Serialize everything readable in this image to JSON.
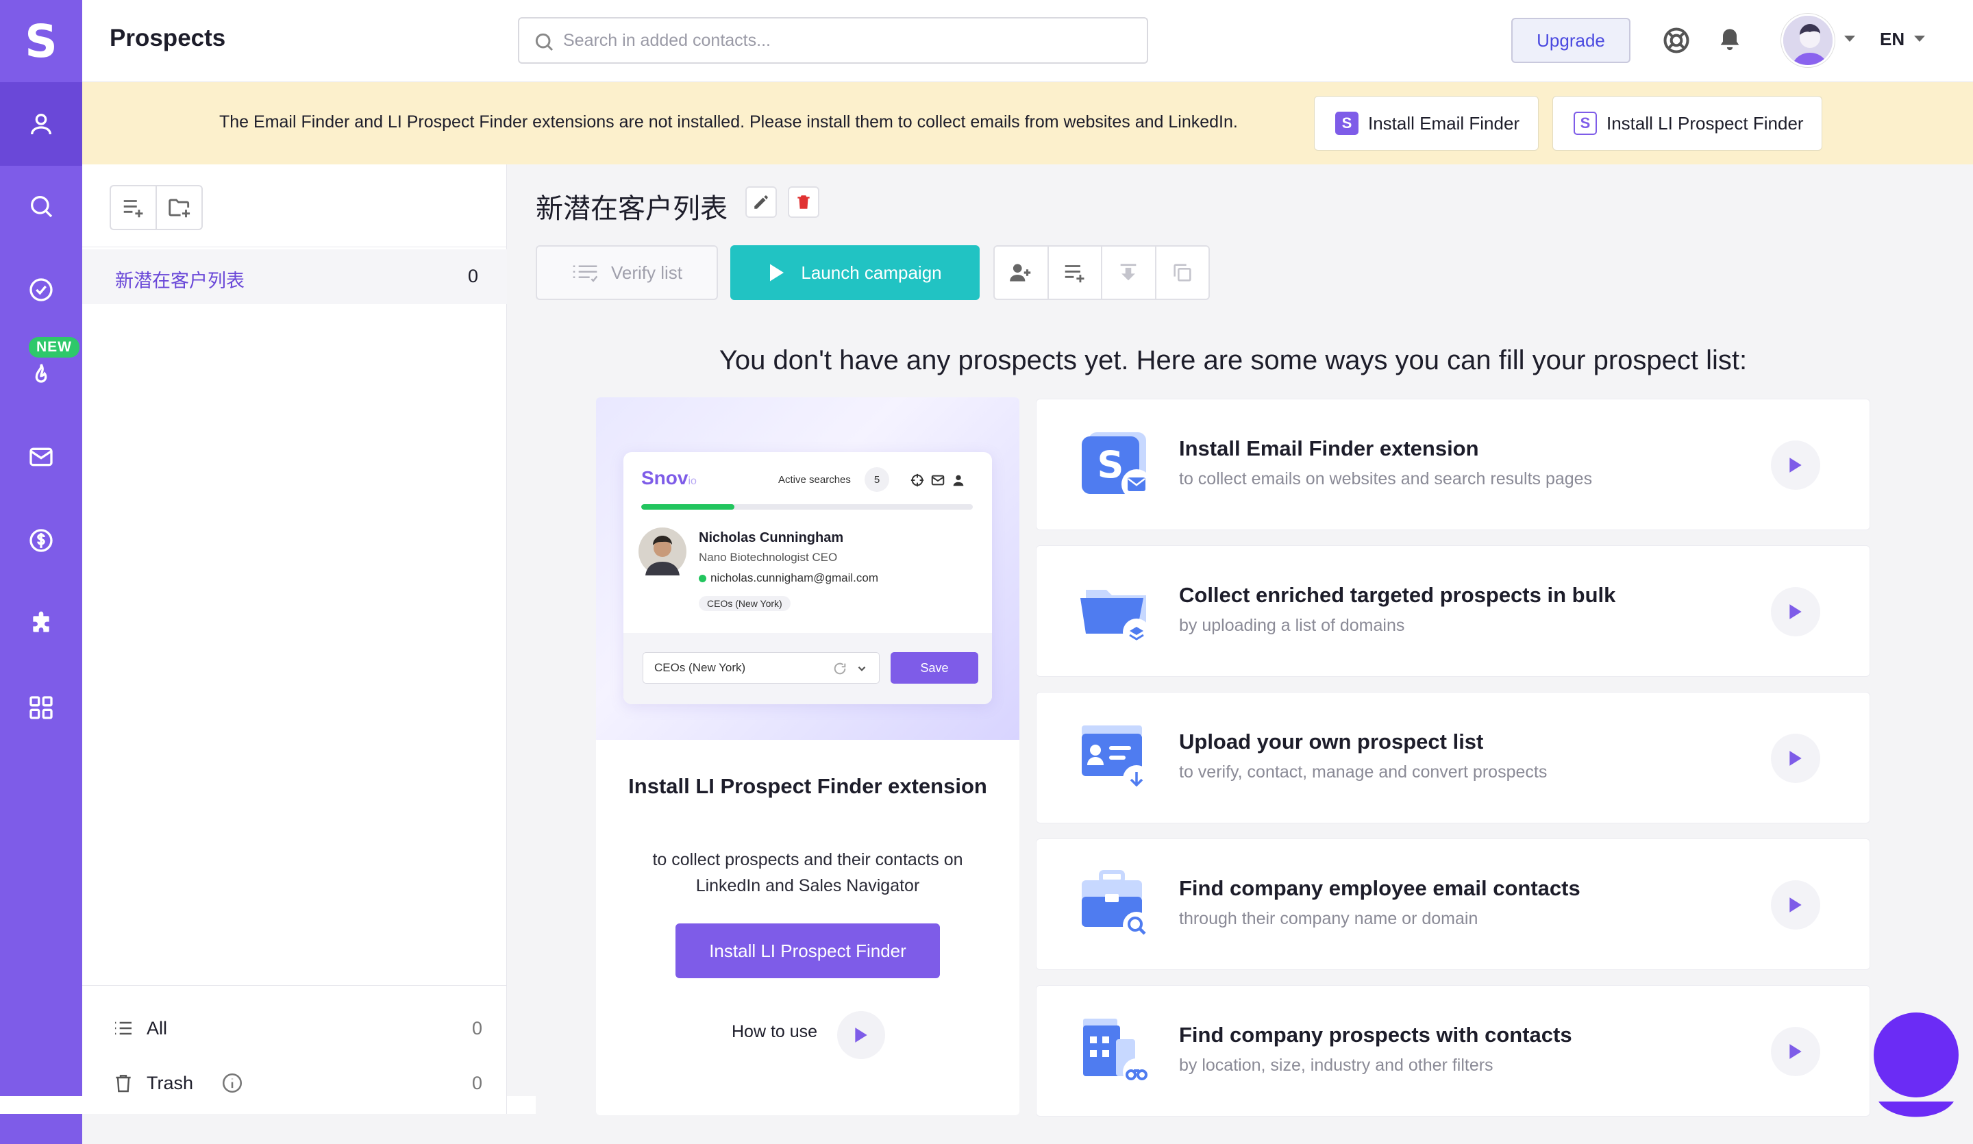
{
  "app": {
    "logo_letter": "S",
    "page_title": "Prospects",
    "new_badge": "NEW"
  },
  "search": {
    "placeholder": "Search in added contacts..."
  },
  "header": {
    "upgrade_label": "Upgrade",
    "language": "EN"
  },
  "banner": {
    "message": "The Email Finder and LI Prospect Finder extensions are not installed. Please install them to collect emails from websites and LinkedIn.",
    "install_email_finder": "Install Email Finder",
    "install_li_finder": "Install LI Prospect Finder"
  },
  "lists": {
    "items": [
      {
        "name": "新潜在客户列表",
        "count": "0"
      }
    ],
    "all": {
      "label": "All",
      "count": "0"
    },
    "trash": {
      "label": "Trash",
      "count": "0"
    }
  },
  "main": {
    "list_title": "新潜在客户列表",
    "verify_label": "Verify list",
    "launch_label": "Launch campaign",
    "empty_heading": "You don't have any prospects yet. Here are some ways you can fill your prospect list:"
  },
  "promo": {
    "mock": {
      "brand": "Snov",
      "brand_suffix": "io",
      "active_searches": "Active searches",
      "active_count": "5",
      "progress": 0.28,
      "person_name": "Nicholas Cunningham",
      "person_role": "Nano Biotechnologist CEO",
      "person_email": "nicholas.cunnigham@gmail.com",
      "tag": "CEOs (New York)",
      "select_value": "CEOs (New York)",
      "save_label": "Save"
    },
    "title": "Install LI Prospect Finder extension",
    "description": "to collect prospects and their contacts on LinkedIn and Sales Navigator",
    "button_label": "Install LI Prospect Finder",
    "how_to_use": "How to use"
  },
  "options": [
    {
      "title": "Install Email Finder extension",
      "subtitle": "to collect emails on websites and search results pages",
      "icon": "email-finder-icon"
    },
    {
      "title": "Collect enriched targeted prospects in bulk",
      "subtitle": "by uploading a list of domains",
      "icon": "folder-layers-icon"
    },
    {
      "title": "Upload your own prospect list",
      "subtitle": "to verify, contact, manage and convert prospects",
      "icon": "contact-card-upload-icon"
    },
    {
      "title": "Find company employee email contacts",
      "subtitle": "through their company name or domain",
      "icon": "briefcase-search-icon"
    },
    {
      "title": "Find company prospects with contacts",
      "subtitle": "by location, size, industry and other filters",
      "icon": "building-binoculars-icon"
    }
  ],
  "colors": {
    "brand": "#7e5ce8",
    "brand_dark": "#6a48d8",
    "teal": "#21c3c3",
    "banner": "#fcf0cc",
    "new_badge": "#2ec86a",
    "delete": "#e03131"
  }
}
